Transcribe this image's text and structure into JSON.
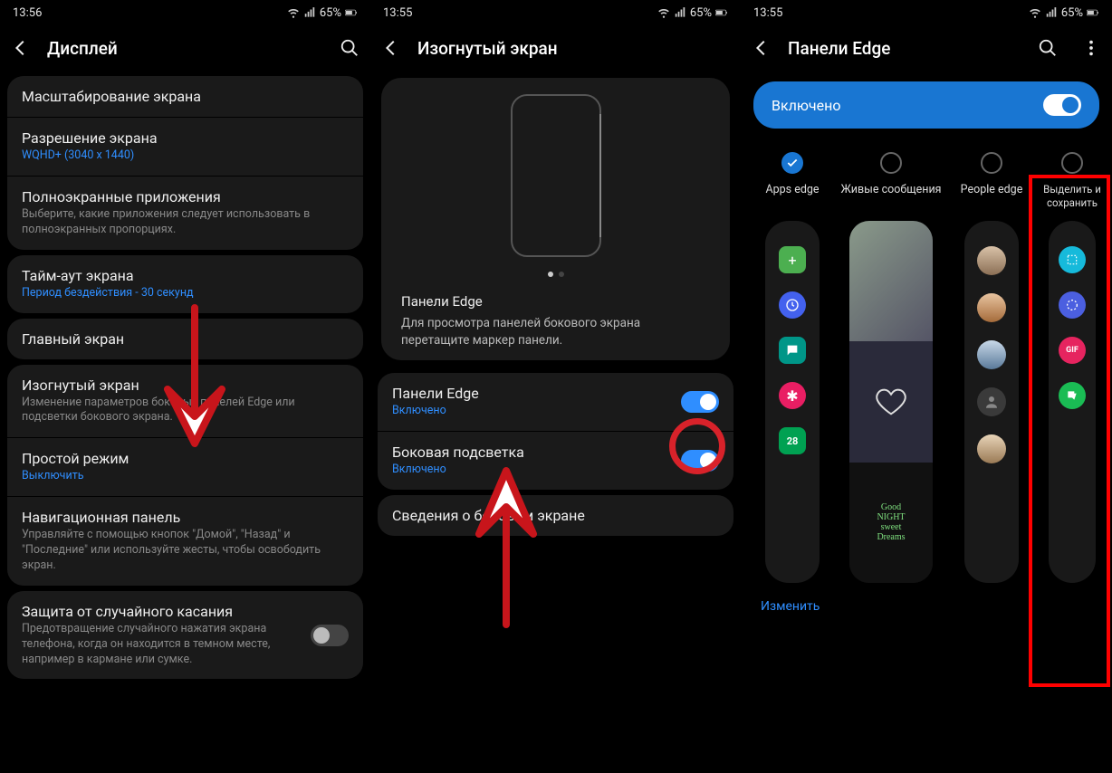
{
  "s1": {
    "time": "13:56",
    "battery": "65%",
    "title": "Дисплей",
    "items": {
      "scaling": "Масштабирование экрана",
      "resolution": "Разрешение экрана",
      "resolution_sub": "WQHD+ (3040 x 1440)",
      "fullscreen": "Полноэкранные приложения",
      "fullscreen_sub": "Выберите, какие приложения следует использовать в полноэкранных пропорциях.",
      "timeout": "Тайм-аут экрана",
      "timeout_sub": "Период бездействия - 30 секунд",
      "home": "Главный экран",
      "edge": "Изогнутый экран",
      "edge_sub": "Изменение параметров боковых панелей Edge или подсветки бокового экрана.",
      "easy": "Простой режим",
      "easy_sub": "Выключить",
      "nav": "Навигационная панель",
      "nav_sub": "Управляйте с помощью кнопок \"Домой\", \"Назад\" и \"Последние\" или используйте жесты, чтобы освободить экран.",
      "touch": "Защита от случайного касания",
      "touch_sub": "Предотвращение случайного нажатия экрана телефона, когда он находится в темном месте, например в кармане или сумке."
    }
  },
  "s2": {
    "time": "13:55",
    "battery": "65%",
    "title": "Изогнутый экран",
    "preview_title": "Панели Edge",
    "preview_desc": "Для просмотра панелей бокового экрана перетащите маркер панели.",
    "panels": "Панели Edge",
    "panels_sub": "Включено",
    "lighting": "Боковая подсветка",
    "lighting_sub": "Включено",
    "about": "Сведения о боковом экране"
  },
  "s3": {
    "time": "13:55",
    "battery": "65%",
    "title": "Панели Edge",
    "master": "Включено",
    "panels": {
      "apps": "Apps edge",
      "live": "Живые сообщения",
      "people": "People edge",
      "select": "Выделить и сохранить"
    },
    "edit": "Изменить",
    "calendar_day": "28",
    "goodnight": "Good\nNIGHT\nsweet\nDreams"
  }
}
